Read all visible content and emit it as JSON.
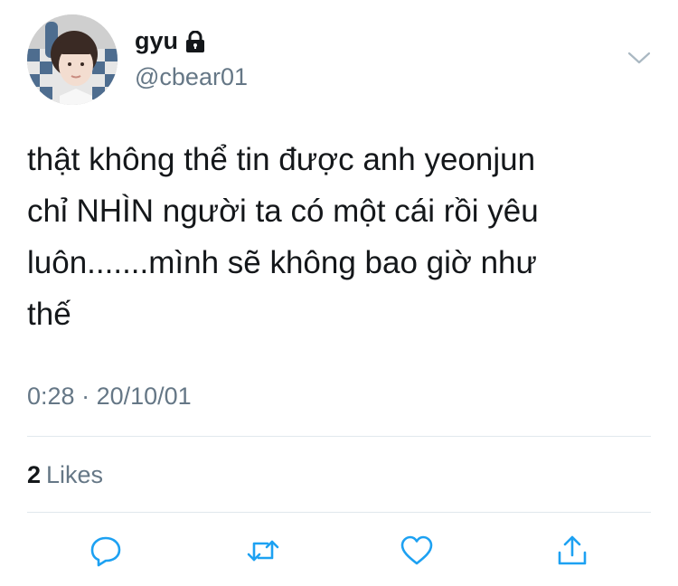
{
  "user": {
    "display_name": "gyu",
    "handle": "@cbear01",
    "protected_icon": "lock-icon",
    "avatar": "profile-photo"
  },
  "tweet": {
    "lines": [
      "thật không thể tin được anh yeonjun",
      "chỉ NHÌN người ta có một cái rồi yêu",
      "luôn.......mình sẽ không bao giờ như",
      "thế"
    ],
    "time": "0:28",
    "separator": "·",
    "date": "20/10/01"
  },
  "stats": {
    "likes_count": "2",
    "likes_label": "Likes"
  },
  "actions": [
    "reply-icon",
    "retweet-icon",
    "like-icon",
    "share-icon"
  ],
  "menu_icon": "chevron-down-icon",
  "colors": {
    "text": "#14171a",
    "secondary": "#657786",
    "icon": "#1da1f2",
    "divider": "#e1e8ed"
  }
}
